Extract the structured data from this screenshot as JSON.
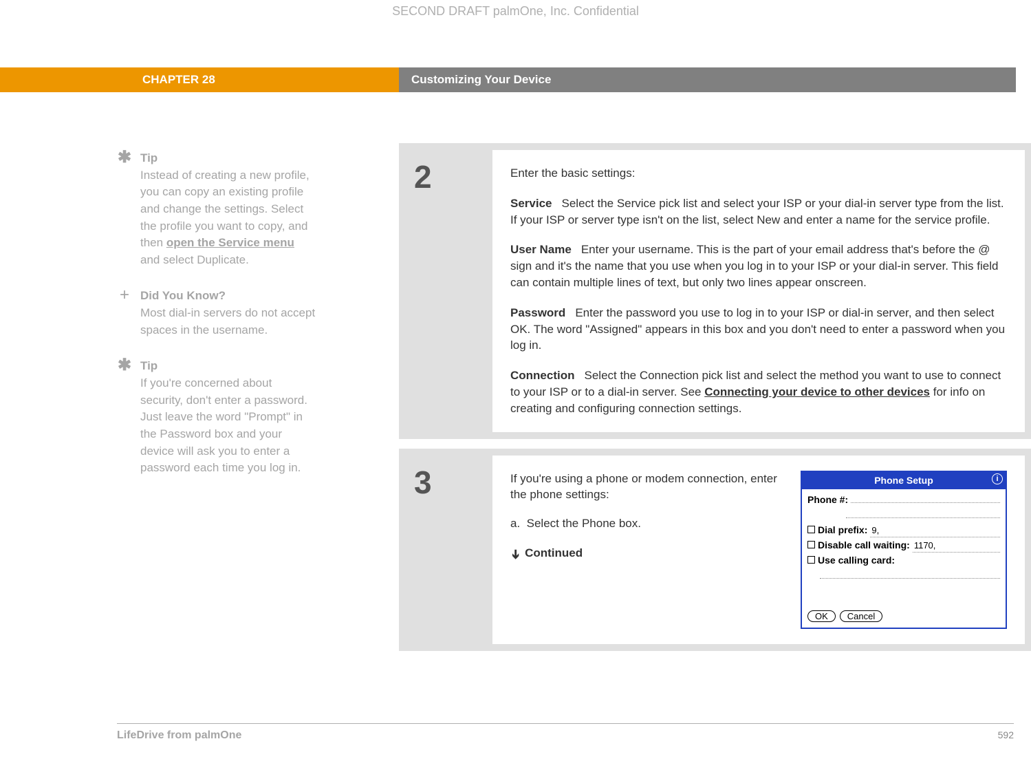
{
  "header": {
    "confidential": "SECOND DRAFT palmOne, Inc.  Confidential",
    "chapter_label": "CHAPTER 28",
    "chapter_title": "Customizing Your Device"
  },
  "sidebar": {
    "tip1": {
      "heading": "Tip",
      "body_before": "Instead of creating a new profile, you can copy an existing profile and change the settings. Select the profile you want to copy, and then ",
      "link": "open the Service menu",
      "body_after": " and select Duplicate."
    },
    "dyk": {
      "heading": "Did You Know?",
      "body": "Most dial-in servers do not accept spaces in the username."
    },
    "tip2": {
      "heading": "Tip",
      "body": "If you're concerned about security, don't enter a password. Just leave the word \"Prompt\" in the Password box and your device will ask you to enter a password each time you log in."
    }
  },
  "steps": {
    "step2": {
      "num": "2",
      "intro": "Enter the basic settings:",
      "service": {
        "label": "Service",
        "text": "Select the Service pick list and select your ISP or your dial-in server type from the list. If your ISP or server type isn't on the list, select New and enter a name for the service profile."
      },
      "username": {
        "label": "User Name",
        "text": "Enter your username. This is the part of your email address that's before the @ sign and it's the name that you use when you log in to your ISP or your dial-in server. This field can contain multiple lines of text, but only two lines appear onscreen."
      },
      "password": {
        "label": "Password",
        "text": "Enter the password you use to log in to your ISP or dial-in server, and then select OK. The word \"Assigned\" appears in this box and you don't need to enter a password when you log in."
      },
      "connection": {
        "label": "Connection",
        "text_before": "Select the Connection pick list and select the method you want to use to connect to your ISP or to a dial-in server. See ",
        "link": "Connecting your device to other devices",
        "text_after": " for info on creating and configuring connection settings."
      }
    },
    "step3": {
      "num": "3",
      "intro": "If you're using a phone or modem connection, enter the phone settings:",
      "sub_a": "a.  Select the Phone box.",
      "continued": "Continued"
    }
  },
  "dialog": {
    "title": "Phone Setup",
    "phone_label": "Phone #:",
    "dial_prefix_label": "Dial prefix:",
    "dial_prefix_value": "9,",
    "disable_cw_label": "Disable call waiting:",
    "disable_cw_value": "1170,",
    "calling_card_label": "Use calling card:",
    "ok": "OK",
    "cancel": "Cancel"
  },
  "footer": {
    "product": "LifeDrive from palmOne",
    "page": "592"
  }
}
